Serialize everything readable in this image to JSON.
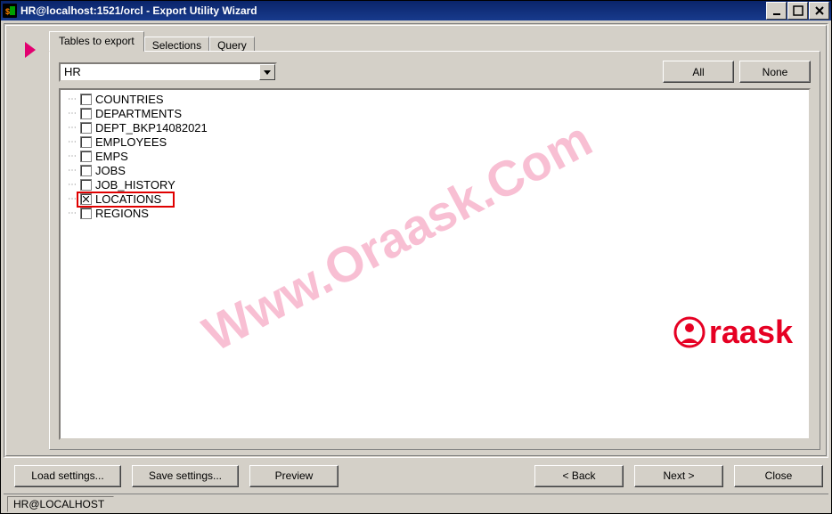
{
  "titlebar": {
    "text": "HR@localhost:1521/orcl - Export Utility Wizard"
  },
  "tabs": {
    "active": "Tables to export",
    "t1": "Selections",
    "t2": "Query"
  },
  "schema_combo": {
    "value": "HR"
  },
  "buttons": {
    "all": "All",
    "none": "None",
    "load": "Load settings...",
    "save": "Save settings...",
    "preview": "Preview",
    "back": "< Back",
    "next": "Next >",
    "close": "Close"
  },
  "tables": {
    "items": [
      {
        "label": "COUNTRIES",
        "checked": false
      },
      {
        "label": "DEPARTMENTS",
        "checked": false
      },
      {
        "label": "DEPT_BKP14082021",
        "checked": false
      },
      {
        "label": "EMPLOYEES",
        "checked": false
      },
      {
        "label": "EMPS",
        "checked": false
      },
      {
        "label": "JOBS",
        "checked": false
      },
      {
        "label": "JOB_HISTORY",
        "checked": false
      },
      {
        "label": "LOCATIONS",
        "checked": true
      },
      {
        "label": "REGIONS",
        "checked": false
      }
    ]
  },
  "watermark": "Www.Oraask.Com",
  "brand": "raask",
  "status": {
    "connection": "HR@LOCALHOST"
  }
}
